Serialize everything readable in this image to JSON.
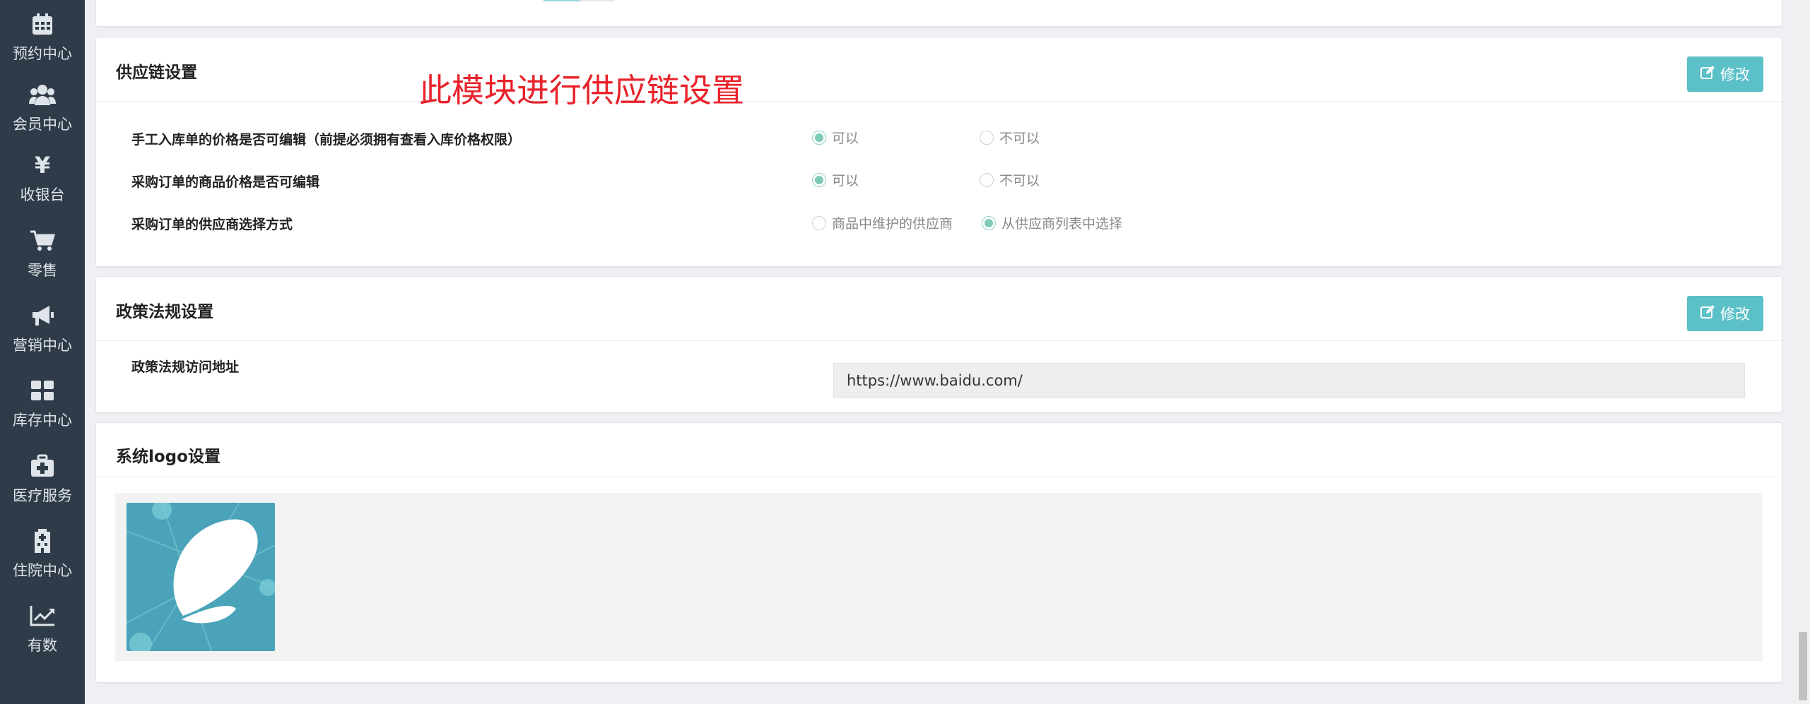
{
  "sidebar": {
    "items": [
      {
        "label": "预约中心",
        "icon": "calendar-icon"
      },
      {
        "label": "会员中心",
        "icon": "users-icon"
      },
      {
        "label": "收银台",
        "icon": "yen-icon"
      },
      {
        "label": "零售",
        "icon": "cart-icon"
      },
      {
        "label": "营销中心",
        "icon": "megaphone-icon"
      },
      {
        "label": "库存中心",
        "icon": "grid-icon"
      },
      {
        "label": "医疗服务",
        "icon": "medkit-icon"
      },
      {
        "label": "住院中心",
        "icon": "hospital-icon"
      },
      {
        "label": "有数",
        "icon": "line-chart-icon"
      }
    ]
  },
  "annotation": "此模块进行供应链设置",
  "edit_label": "修改",
  "supply_chain": {
    "title": "供应链设置",
    "rows": [
      {
        "label": "手工入库单的价格是否可编辑（前提必须拥有查看入库价格权限）",
        "options": [
          "可以",
          "不可以"
        ],
        "selected": 0
      },
      {
        "label": "采购订单的商品价格是否可编辑",
        "options": [
          "可以",
          "不可以"
        ],
        "selected": 0
      },
      {
        "label": "采购订单的供应商选择方式",
        "options": [
          "商品中维护的供应商",
          "从供应商列表中选择"
        ],
        "selected": 1
      }
    ]
  },
  "policy": {
    "title": "政策法规设置",
    "field_label": "政策法规访问地址",
    "url": "https://www.baidu.com/"
  },
  "logo": {
    "title": "系统logo设置"
  },
  "colors": {
    "sidebar_bg": "#2f3b48",
    "accent": "#5bc0c7",
    "annotation": "#e8222b"
  }
}
